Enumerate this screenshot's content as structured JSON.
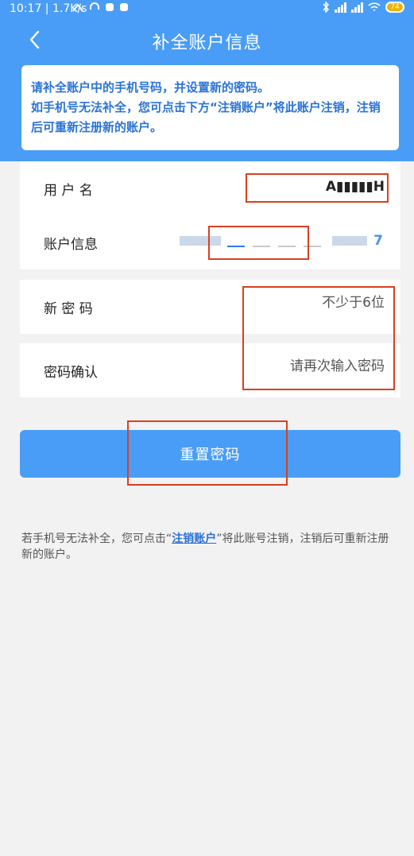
{
  "status_bar": {
    "time_speed": "10:17 | 1.7K/s",
    "icons": [
      "hotspot-icon",
      "headset-icon",
      "app-icon",
      "app-icon"
    ],
    "right_icons": [
      "bluetooth-icon",
      "signal-hd-icon",
      "signal-hd-icon",
      "wifi-icon",
      "battery-icon"
    ],
    "battery": "74"
  },
  "header": {
    "title": "补全账户信息"
  },
  "notice": {
    "line1": "请补全账户中的手机号码，并设置新的密码。",
    "line2": "如手机号无法补全，您可点击下方“注销账户”将此账户注销，注销后可重新注册新的账户。"
  },
  "form": {
    "username": {
      "label": "用 户 名",
      "value": "A▮▮▮▮▮H"
    },
    "account_info": {
      "label": "账户信息",
      "tail": "7"
    },
    "new_password": {
      "label": "新 密 码",
      "placeholder": "不少于6位"
    },
    "confirm_password": {
      "label": "密码确认",
      "placeholder": "请再次输入密码"
    }
  },
  "reset_button": {
    "label": "重置密码"
  },
  "bottom_note": {
    "prefix": "若手机号无法补全，您可点击“",
    "link": "注销账户",
    "suffix": "”将此账号注销，注销后可重新注册新的账户。"
  },
  "colors": {
    "primary": "#4a9df6",
    "notice_text": "#2b73d6",
    "highlight": "#d8401f",
    "background": "#f2f2f2"
  }
}
